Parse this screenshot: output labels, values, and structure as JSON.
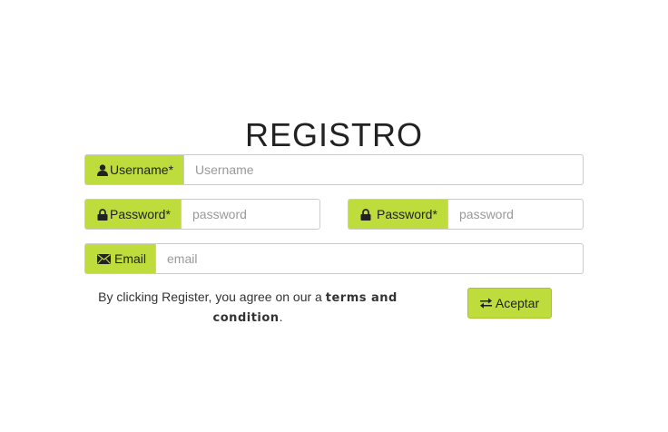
{
  "form": {
    "title": "REGISTRO",
    "username": {
      "label": "Username*",
      "placeholder": "Username",
      "value": ""
    },
    "password": {
      "label": "Password*",
      "placeholder": "password",
      "value": ""
    },
    "password_confirm": {
      "label": "Password*",
      "placeholder": "password",
      "value": ""
    },
    "email": {
      "label": "Email",
      "placeholder": "email",
      "value": ""
    },
    "terms_prefix": "By clicking Register, you agree on our a",
    "terms_link": "terms and condition",
    "terms_suffix": ".",
    "submit_label": "Aceptar"
  },
  "icons": {
    "username": "user-icon",
    "password": "lock-icon",
    "password_confirm": "lock-icon",
    "email": "envelope-icon",
    "submit": "exchange-icon"
  },
  "colors": {
    "accent": "#bedc3c",
    "border": "#cccccc",
    "text": "#222222",
    "placeholder": "#999999"
  }
}
